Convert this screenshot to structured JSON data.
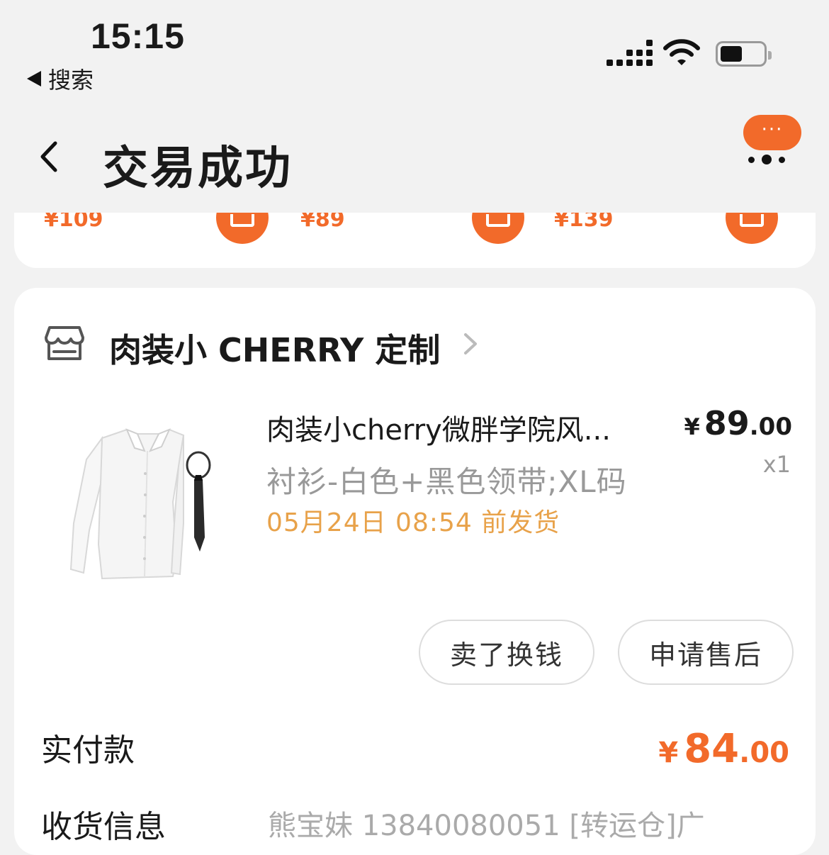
{
  "status_bar": {
    "time": "15:15",
    "back_app": "搜索"
  },
  "header": {
    "title": "交易成功",
    "more_dots": "···"
  },
  "recommendations": [
    {
      "price": "¥109"
    },
    {
      "price": "¥89"
    },
    {
      "price": "¥139"
    }
  ],
  "order": {
    "store_name": "肉装小 CHERRY 定制",
    "product": {
      "name": "肉装小cherry微胖学院风...",
      "sku": "衬衫-白色+黑色领带;XL码",
      "ship_time": "05月24日 08:54 前发货",
      "price_currency": "¥",
      "price_int": "89",
      "price_dec": ".00",
      "quantity": "x1"
    },
    "buttons": {
      "sell": "卖了换钱",
      "after_sale": "申请售后"
    },
    "paid": {
      "label": "实付款",
      "currency": "¥",
      "int": "84",
      "dec": ".00"
    },
    "address": {
      "label": "收货信息",
      "value": "熊宝妹 13840080051 [转运仓]广"
    }
  },
  "colors": {
    "accent": "#f26a2a",
    "ship_time": "#e8a24a"
  }
}
